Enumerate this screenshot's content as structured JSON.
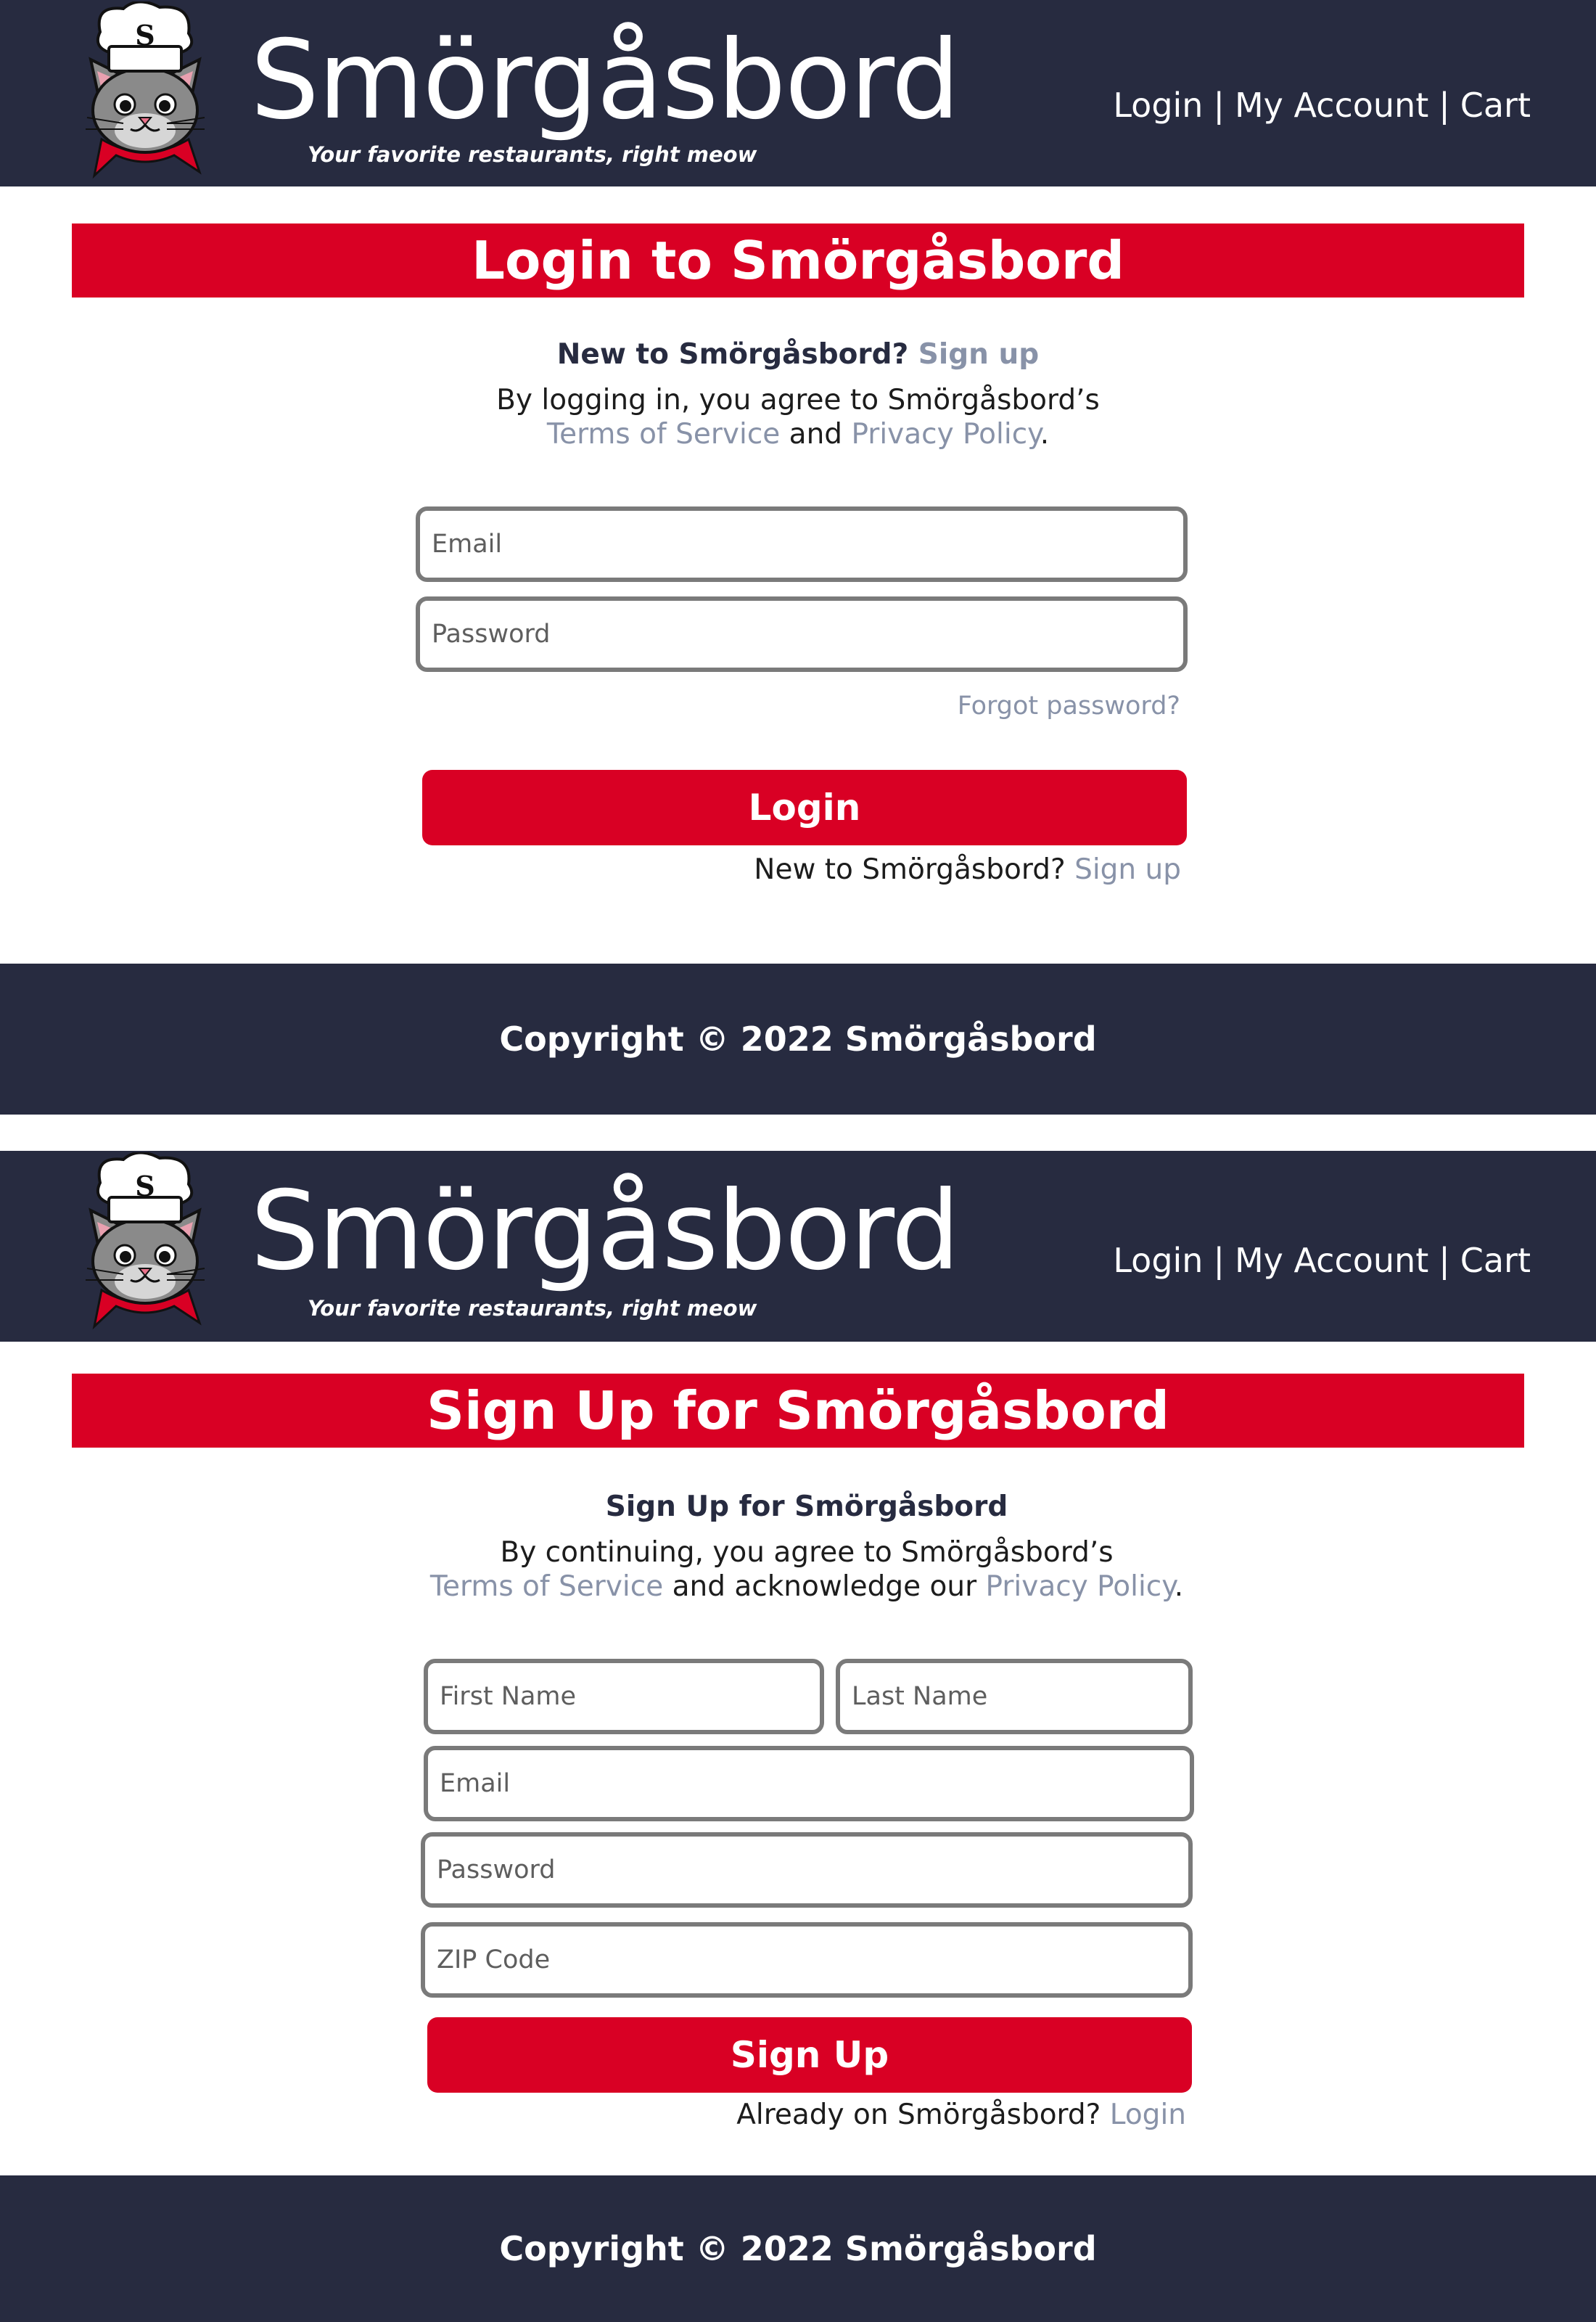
{
  "colors": {
    "header_bg": "#272b40",
    "accent_red": "#d90024",
    "link_gray": "#8892a8",
    "text_dark": "#1c1c1c"
  },
  "header": {
    "logo_icon": "chef-cat-logo-icon",
    "logo_letter": "S",
    "brand_name": "Smörgåsbord",
    "tagline": "Your favorite restaurants, right meow",
    "nav": {
      "login": "Login",
      "separator": "|",
      "my_account": "My Account",
      "cart": "Cart"
    }
  },
  "login_page": {
    "banner_title": "Login to Smörgåsbord",
    "intro": {
      "new_question": "New to Smörgåsbord?",
      "sign_up_link": "Sign up",
      "agree_text": "By logging in, you agree to Smörgåsbord’s",
      "terms_link": "Terms of Service",
      "and_text": "and",
      "privacy_link": "Privacy Policy",
      "period": "."
    },
    "form": {
      "email_placeholder": "Email",
      "password_placeholder": "Password",
      "forgot_link": "Forgot password?",
      "submit_label": "Login"
    },
    "switch": {
      "text": "New to Smörgåsbord?",
      "link": "Sign up"
    }
  },
  "signup_page": {
    "banner_title": "Sign Up for Smörgåsbord",
    "intro": {
      "heading": "Sign Up for Smörgåsbord",
      "agree_text": "By continuing, you agree to Smörgåsbord’s",
      "terms_link": "Terms of Service",
      "acknowledge_text": "and acknowledge our",
      "privacy_link": "Privacy Policy",
      "period": "."
    },
    "form": {
      "first_name_placeholder": "First Name",
      "last_name_placeholder": "Last Name",
      "email_placeholder": "Email",
      "password_placeholder": "Password",
      "zip_placeholder": "ZIP Code",
      "submit_label": "Sign Up"
    },
    "switch": {
      "text": "Already on Smörgåsbord?",
      "link": "Login"
    }
  },
  "footer": {
    "copyright": "Copyright © 2022 Smörgåsbord"
  }
}
